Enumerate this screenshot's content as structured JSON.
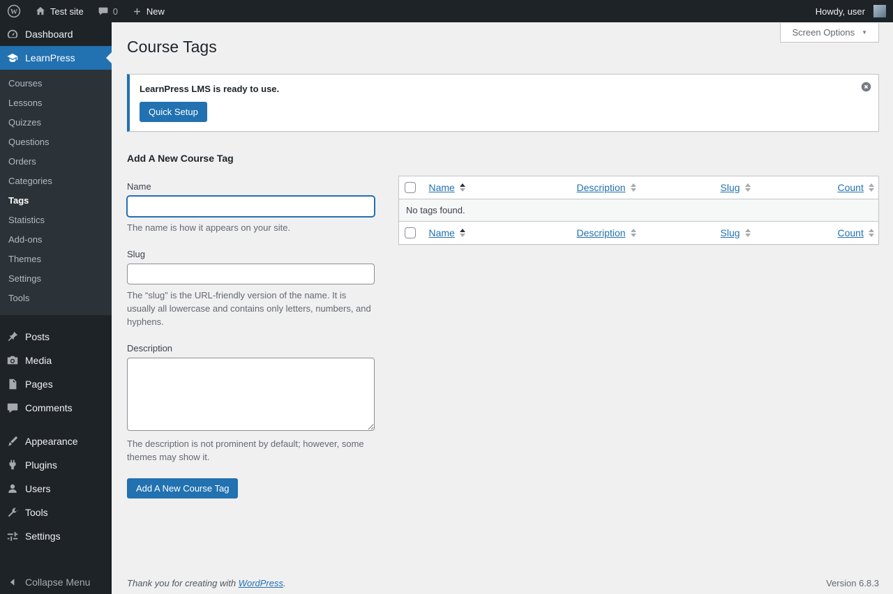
{
  "colors": {
    "accent": "#2271b1",
    "admin_bar_bg": "#1d2327",
    "content_bg": "#f0f0f1",
    "notice_border": "#2271b1",
    "menu_highlight": "#2271b1"
  },
  "admin_bar": {
    "site_name": "Test site",
    "comments_count": "0",
    "new_label": "New",
    "howdy": "Howdy, user"
  },
  "sidebar": {
    "dashboard": "Dashboard",
    "learnpress": "LearnPress",
    "submenu": [
      "Courses",
      "Lessons",
      "Quizzes",
      "Questions",
      "Orders",
      "Categories",
      "Tags",
      "Statistics",
      "Add-ons",
      "Themes",
      "Settings",
      "Tools"
    ],
    "posts": "Posts",
    "media": "Media",
    "pages": "Pages",
    "comments": "Comments",
    "appearance": "Appearance",
    "plugins": "Plugins",
    "users": "Users",
    "tools": "Tools",
    "settings": "Settings",
    "collapse": "Collapse Menu"
  },
  "main": {
    "title": "Course Tags",
    "screen_options": "Screen Options",
    "notice": {
      "text": "LearnPress LMS is ready to use.",
      "button": "Quick Setup"
    },
    "form": {
      "heading": "Add A New Course Tag",
      "name_label": "Name",
      "name_help": "The name is how it appears on your site.",
      "slug_label": "Slug",
      "slug_help": "The “slug” is the URL-friendly version of the name. It is usually all lowercase and contains only letters, numbers, and hyphens.",
      "description_label": "Description",
      "description_help": "The description is not prominent by default; however, some themes may show it.",
      "submit": "Add A New Course Tag"
    },
    "table": {
      "columns": [
        "Name",
        "Description",
        "Slug",
        "Count"
      ],
      "empty": "No tags found."
    }
  },
  "footer": {
    "thanks_prefix": "Thank you for creating with ",
    "wordpress": "WordPress",
    "thanks_suffix": ".",
    "version": "Version 6.8.3"
  }
}
